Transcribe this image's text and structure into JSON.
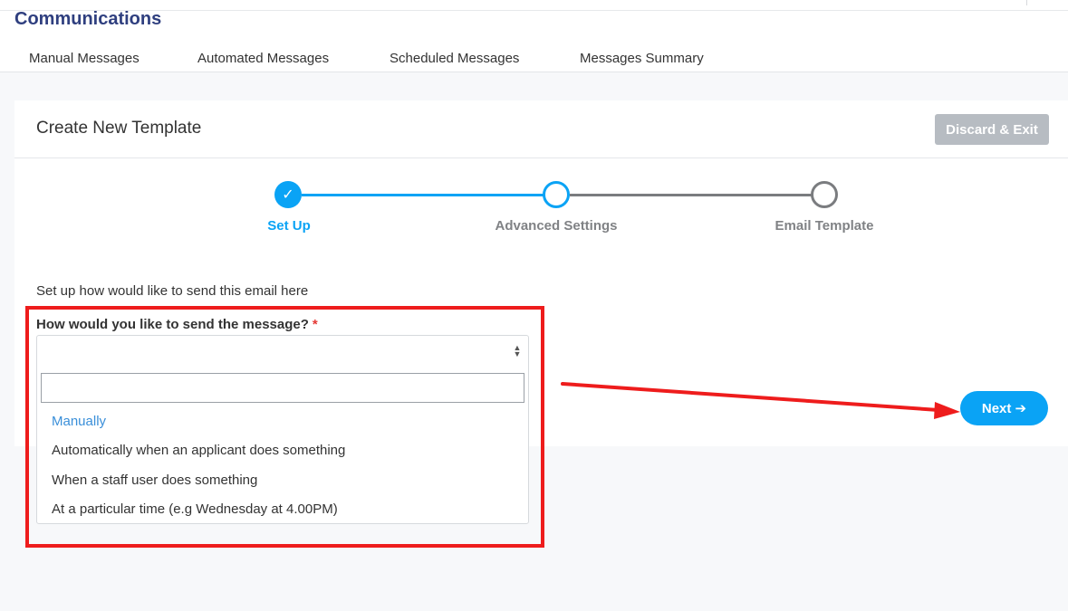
{
  "app": {
    "title": "Communications"
  },
  "nav": {
    "tabs": [
      {
        "label": "Manual Messages"
      },
      {
        "label": "Automated Messages"
      },
      {
        "label": "Scheduled Messages"
      },
      {
        "label": "Messages Summary"
      }
    ]
  },
  "card": {
    "title": "Create New Template",
    "discard_label": "Discard & Exit"
  },
  "stepper": {
    "steps": [
      {
        "label": "Set Up",
        "state": "complete"
      },
      {
        "label": "Advanced Settings",
        "state": "current"
      },
      {
        "label": "Email Template",
        "state": "pending"
      }
    ],
    "check_glyph": "✓"
  },
  "form": {
    "intro": "Set up how would like to send this email here",
    "question": "How would you like to send the message?",
    "required_mark": "*",
    "selected_value": "",
    "search_value": "",
    "options": [
      {
        "label": "Manually",
        "highlighted": true
      },
      {
        "label": "Automatically when an applicant does something",
        "highlighted": false
      },
      {
        "label": "When a staff user does something",
        "highlighted": false
      },
      {
        "label": "At a particular time (e.g Wednesday at 4.00PM)",
        "highlighted": false
      }
    ]
  },
  "actions": {
    "next_label": "Next ➔"
  },
  "colors": {
    "brand_title": "#2f3f7f",
    "accent_blue": "#0aa3f5",
    "step_inactive": "#7a7c7f",
    "annotation_red": "#ee1c1c",
    "discard_gray": "#b7bcc2"
  },
  "icons": {
    "step_complete": "check-icon",
    "select_toggle": "sort-arrows-icon",
    "next": "arrow-right-icon"
  }
}
